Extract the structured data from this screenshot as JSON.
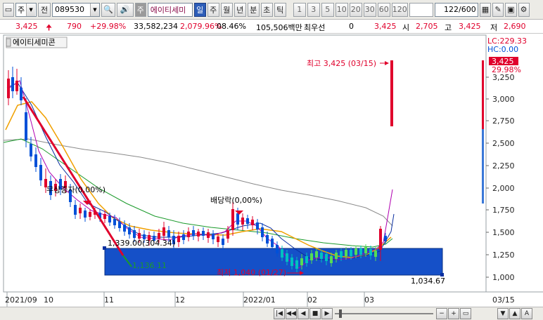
{
  "toolbar": {
    "market_type": "주",
    "view_mode": "전",
    "stock_code": "089530",
    "flag": "주",
    "stock_name": "에이티세미",
    "periods": [
      "일",
      "주",
      "월",
      "년",
      "분",
      "초",
      "틱"
    ],
    "active_period": "일",
    "intervals": [
      "1",
      "3",
      "5",
      "10",
      "20",
      "30",
      "60",
      "120"
    ],
    "count_display": "122/600"
  },
  "quote": {
    "price": "3,425",
    "change": "790",
    "change_pct": "+29.98%",
    "volume": "33,582,234",
    "volume_pct": "2,079.96%",
    "turnover": "08.46%",
    "amount": "105,506백만",
    "preferred_label": "최우선",
    "preferred_value": "0",
    "last": "3,425",
    "open_label": "시",
    "open_value": "2,705",
    "high_label": "고",
    "high_value": "3,425",
    "low_label": "저",
    "low_value": "2,690"
  },
  "chart": {
    "legend_name": "에이티세미콘",
    "lc_label": "LC:229.33",
    "hc_label": "HC:0.00",
    "current_price_tag": "3,425",
    "current_pct_tag": "29.98%",
    "y_ticks": [
      "3,250",
      "3,000",
      "2,750",
      "2,500",
      "2,250",
      "2,000",
      "1,750",
      "1,500",
      "1,250",
      "1,000"
    ],
    "x_ticks": [
      "2021/09",
      "10",
      "11",
      "12",
      "2022/01",
      "02",
      "03",
      "03/15"
    ],
    "annotations": {
      "high": "최고 3,425 (03/15)",
      "low": "최저 1,040 (01/27)",
      "ex_rights": "무상증자(0,00%)",
      "ex_dividend": "배당락(0,00%)",
      "box_top": "1,339.00(304.34)",
      "box_bottom": "1,034.67",
      "trend_end": "1,136.11"
    },
    "colors": {
      "up": "#e0002c",
      "down": "#0050d8",
      "box": "#1550c8",
      "ma5": "#b000b0",
      "ma20": "#0a2fa0",
      "ma60": "#f0a000",
      "ma120": "#1a9a2a",
      "ma240": "#8a8a8a"
    }
  }
}
